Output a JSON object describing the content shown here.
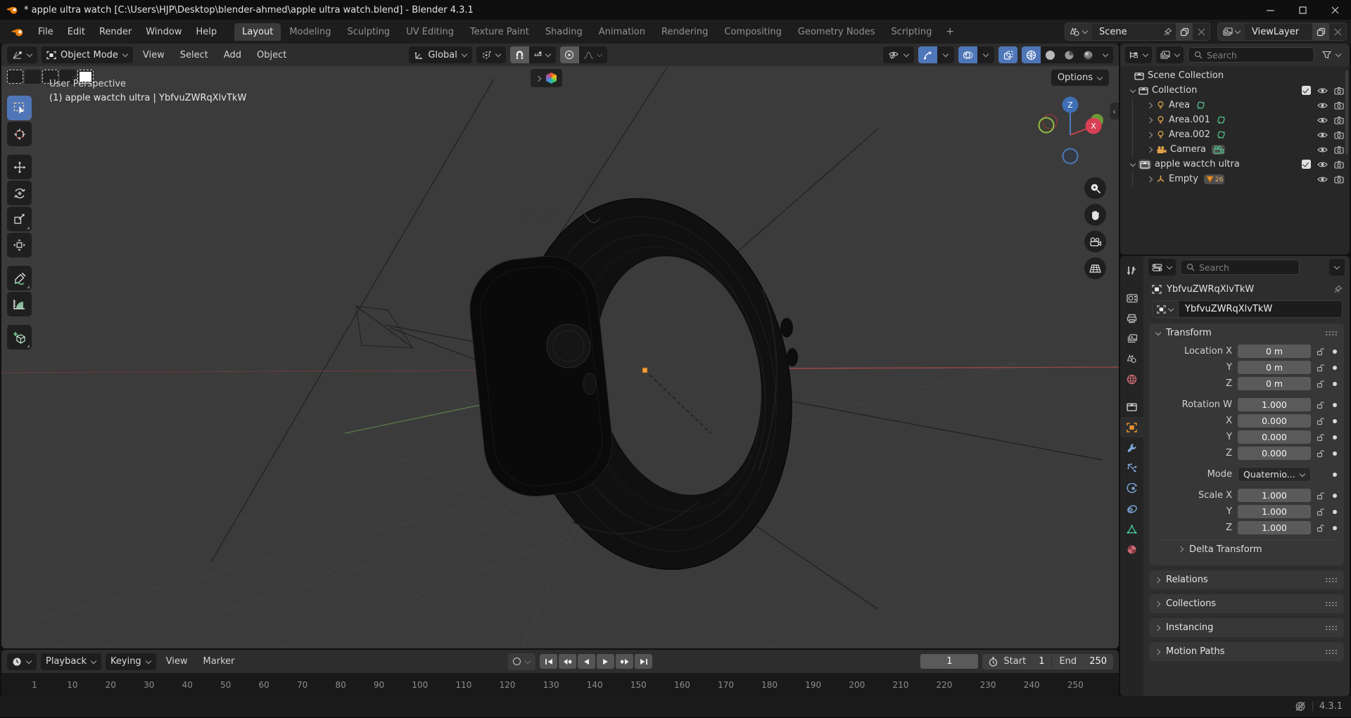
{
  "window": {
    "title": "* apple ultra watch [C:\\Users\\HJP\\Desktop\\blender-ahmed\\apple ultra watch.blend] - Blender 4.3.1"
  },
  "topbar": {
    "menus": [
      "File",
      "Edit",
      "Render",
      "Window",
      "Help"
    ],
    "workspaces": [
      "Layout",
      "Modeling",
      "Sculpting",
      "UV Editing",
      "Texture Paint",
      "Shading",
      "Animation",
      "Rendering",
      "Compositing",
      "Geometry Nodes",
      "Scripting"
    ],
    "active_workspace": "Layout",
    "add_workspace": "+",
    "scene_label": "Scene",
    "view_layer_label": "ViewLayer"
  },
  "viewport": {
    "mode": "Object Mode",
    "menus": [
      "View",
      "Select",
      "Add",
      "Object"
    ],
    "orientation": "Global",
    "options_label": "Options",
    "overlay_line1": "User Perspective",
    "overlay_line2": "(1) apple wactch ultra | YbfvuZWRqXlvTkW",
    "gizmo": {
      "z": "Z",
      "x": "X"
    }
  },
  "outliner": {
    "search_placeholder": "Search",
    "rows": [
      {
        "label": "Scene Collection"
      },
      {
        "label": "Collection"
      },
      {
        "label": "Area"
      },
      {
        "label": "Area.001"
      },
      {
        "label": "Area.002"
      },
      {
        "label": "Camera"
      },
      {
        "label": "apple wactch ultra"
      },
      {
        "label": "Empty",
        "badge_count": "26"
      }
    ]
  },
  "properties": {
    "search_placeholder": "Search",
    "breadcrumb_object": "YbfvuZWRqXlvTkW",
    "object_name": "YbfvuZWRqXlvTkW",
    "transform": {
      "title": "Transform",
      "location": [
        {
          "label": "Location X",
          "value": "0 m"
        },
        {
          "label": "Y",
          "value": "0 m"
        },
        {
          "label": "Z",
          "value": "0 m"
        }
      ],
      "rotation": [
        {
          "label": "Rotation W",
          "value": "1.000"
        },
        {
          "label": "X",
          "value": "0.000"
        },
        {
          "label": "Y",
          "value": "0.000"
        },
        {
          "label": "Z",
          "value": "0.000"
        }
      ],
      "mode_label": "Mode",
      "mode_value": "Quaternio...",
      "scale": [
        {
          "label": "Scale X",
          "value": "1.000"
        },
        {
          "label": "Y",
          "value": "1.000"
        },
        {
          "label": "Z",
          "value": "1.000"
        }
      ],
      "delta_label": "Delta Transform"
    },
    "panels": [
      "Relations",
      "Collections",
      "Instancing",
      "Motion Paths"
    ]
  },
  "timeline": {
    "menus": [
      "Playback",
      "Keying",
      "View",
      "Marker"
    ],
    "current_frame": "1",
    "start_label": "Start",
    "start_value": "1",
    "end_label": "End",
    "end_value": "250",
    "ticks": [
      "1",
      "10",
      "20",
      "30",
      "40",
      "50",
      "60",
      "70",
      "80",
      "90",
      "100",
      "110",
      "120",
      "130",
      "140",
      "150",
      "160",
      "170",
      "180",
      "190",
      "200",
      "210",
      "220",
      "230",
      "240",
      "250"
    ]
  },
  "statusbar": {
    "version": "4.3.1"
  },
  "colors": {
    "accent": "#4f76b8",
    "orange": "#e8912d",
    "green_data": "#52c08a",
    "axis_x": "#95484b",
    "axis_y": "#5c7a45"
  }
}
